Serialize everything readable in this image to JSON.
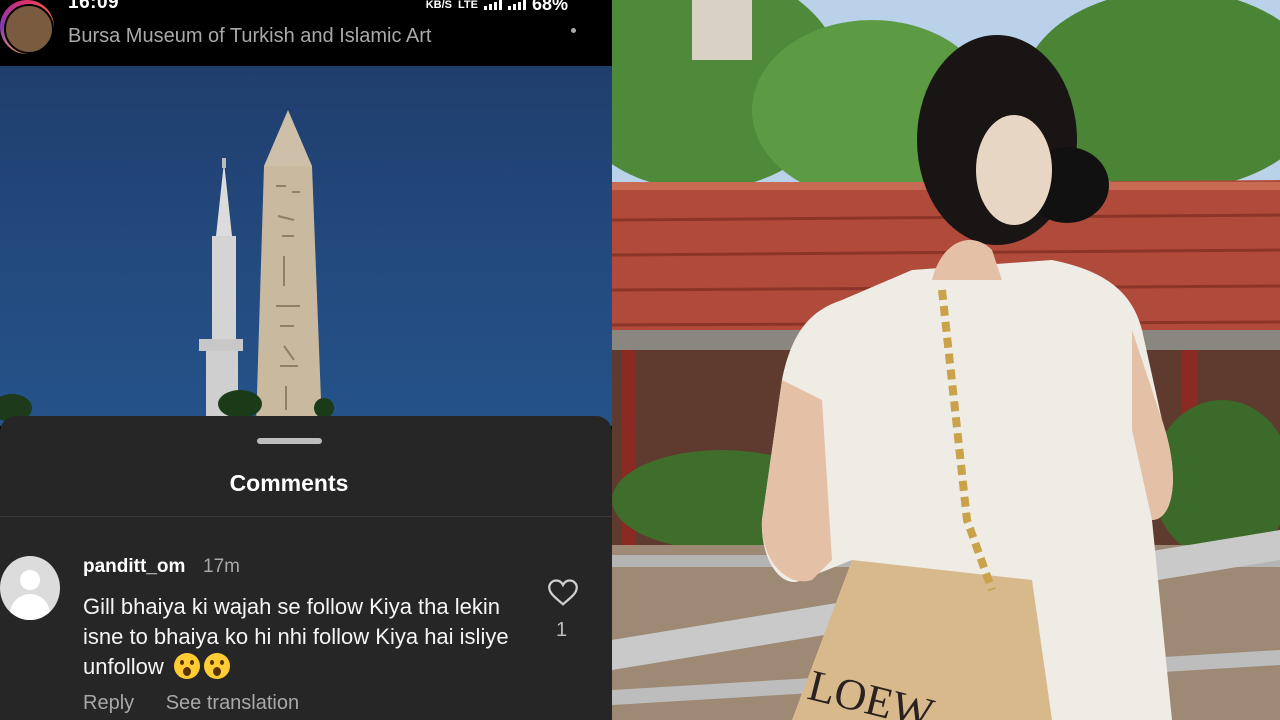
{
  "status_bar": {
    "time": "16:09",
    "network_speed": "KB/S",
    "network_type": "LTE",
    "battery": "68%"
  },
  "post": {
    "location": "Bursa Museum of Turkish and Islamic Art"
  },
  "comments_sheet": {
    "title": "Comments",
    "comment": {
      "username": "panditt_om",
      "time_ago": "17m",
      "text": "Gill bhaiya ki wajah se follow Kiya tha lekin isne to bhaiya ko hi nhi follow Kiya hai isliye unfollow",
      "emojis": [
        "astonished-face",
        "astonished-face"
      ],
      "like_count": "1",
      "reply_label": "Reply",
      "translation_label": "See translation"
    }
  },
  "colors": {
    "sheet_background": "#262626",
    "sky": "#23497d",
    "roof_tiles": "#b04a3a",
    "muted_text": "#a8a8a8"
  },
  "icons": [
    "heart-icon",
    "more-icon",
    "signal-icon",
    "battery-icon"
  ]
}
